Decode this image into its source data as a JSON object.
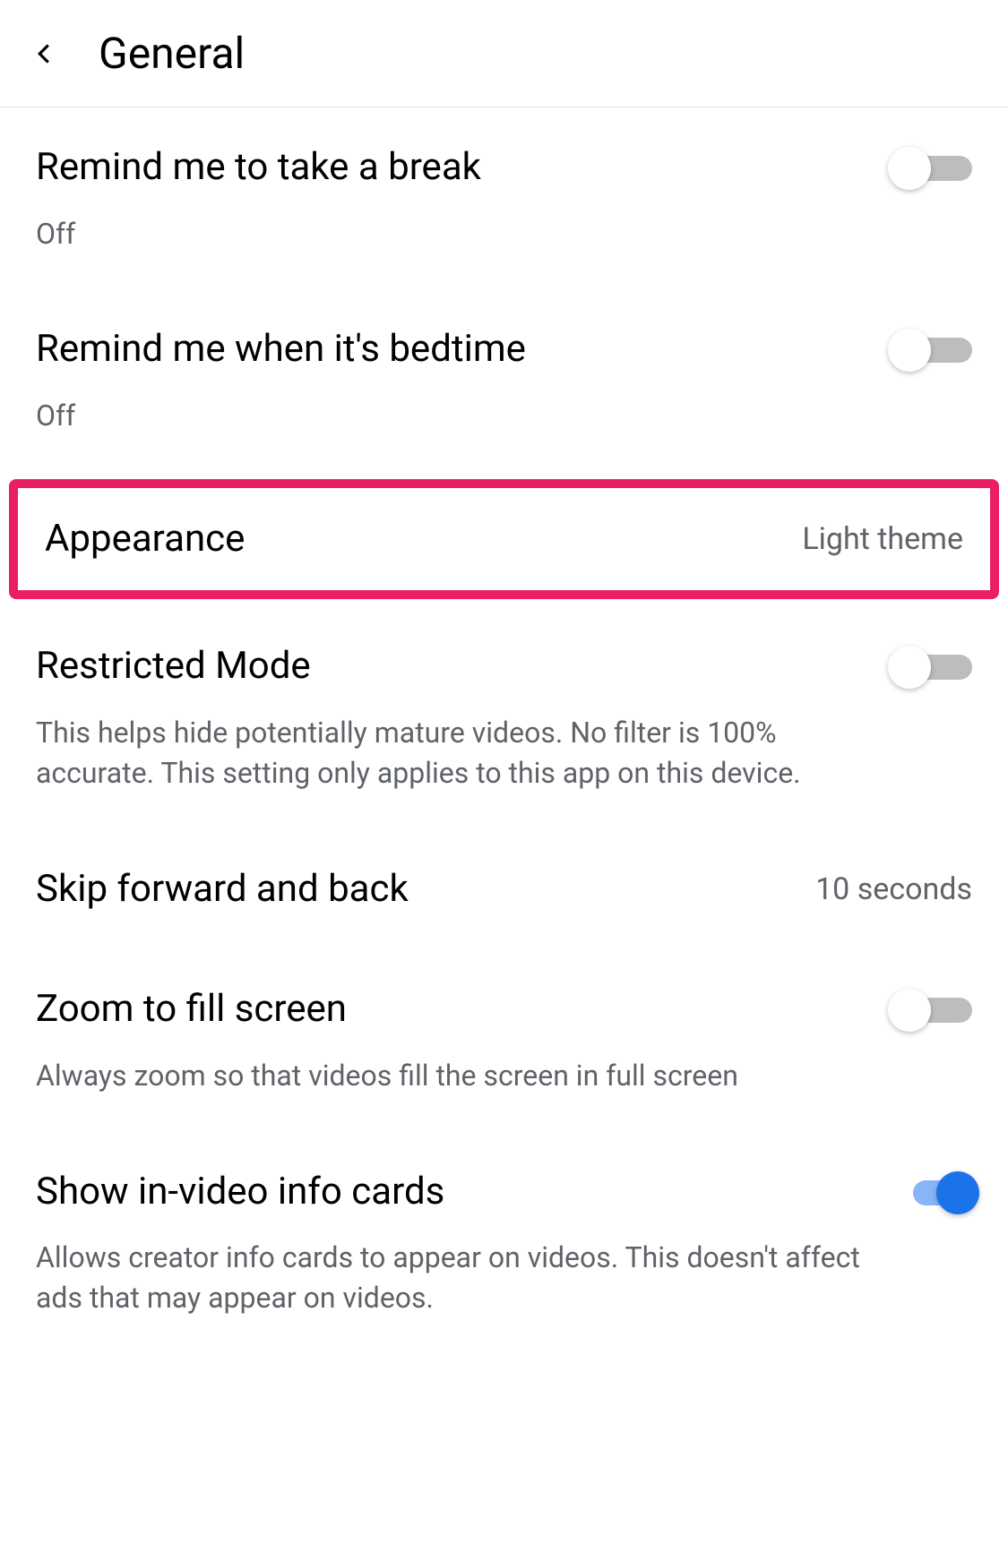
{
  "header": {
    "title": "General"
  },
  "settings": {
    "break_reminder": {
      "title": "Remind me to take a break",
      "subtitle": "Off",
      "enabled": false
    },
    "bedtime_reminder": {
      "title": "Remind me when it's bedtime",
      "subtitle": "Off",
      "enabled": false
    },
    "appearance": {
      "title": "Appearance",
      "value": "Light theme"
    },
    "restricted_mode": {
      "title": "Restricted Mode",
      "subtitle": "This helps hide potentially mature videos. No filter is 100% accurate. This setting only applies to this app on this device.",
      "enabled": false
    },
    "skip": {
      "title": "Skip forward and back",
      "value": "10 seconds"
    },
    "zoom": {
      "title": "Zoom to fill screen",
      "subtitle": "Always zoom so that videos fill the screen in full screen",
      "enabled": false
    },
    "info_cards": {
      "title": "Show in-video info cards",
      "subtitle": "Allows creator info cards to appear on videos. This doesn't affect ads that may appear on videos.",
      "enabled": true
    }
  }
}
